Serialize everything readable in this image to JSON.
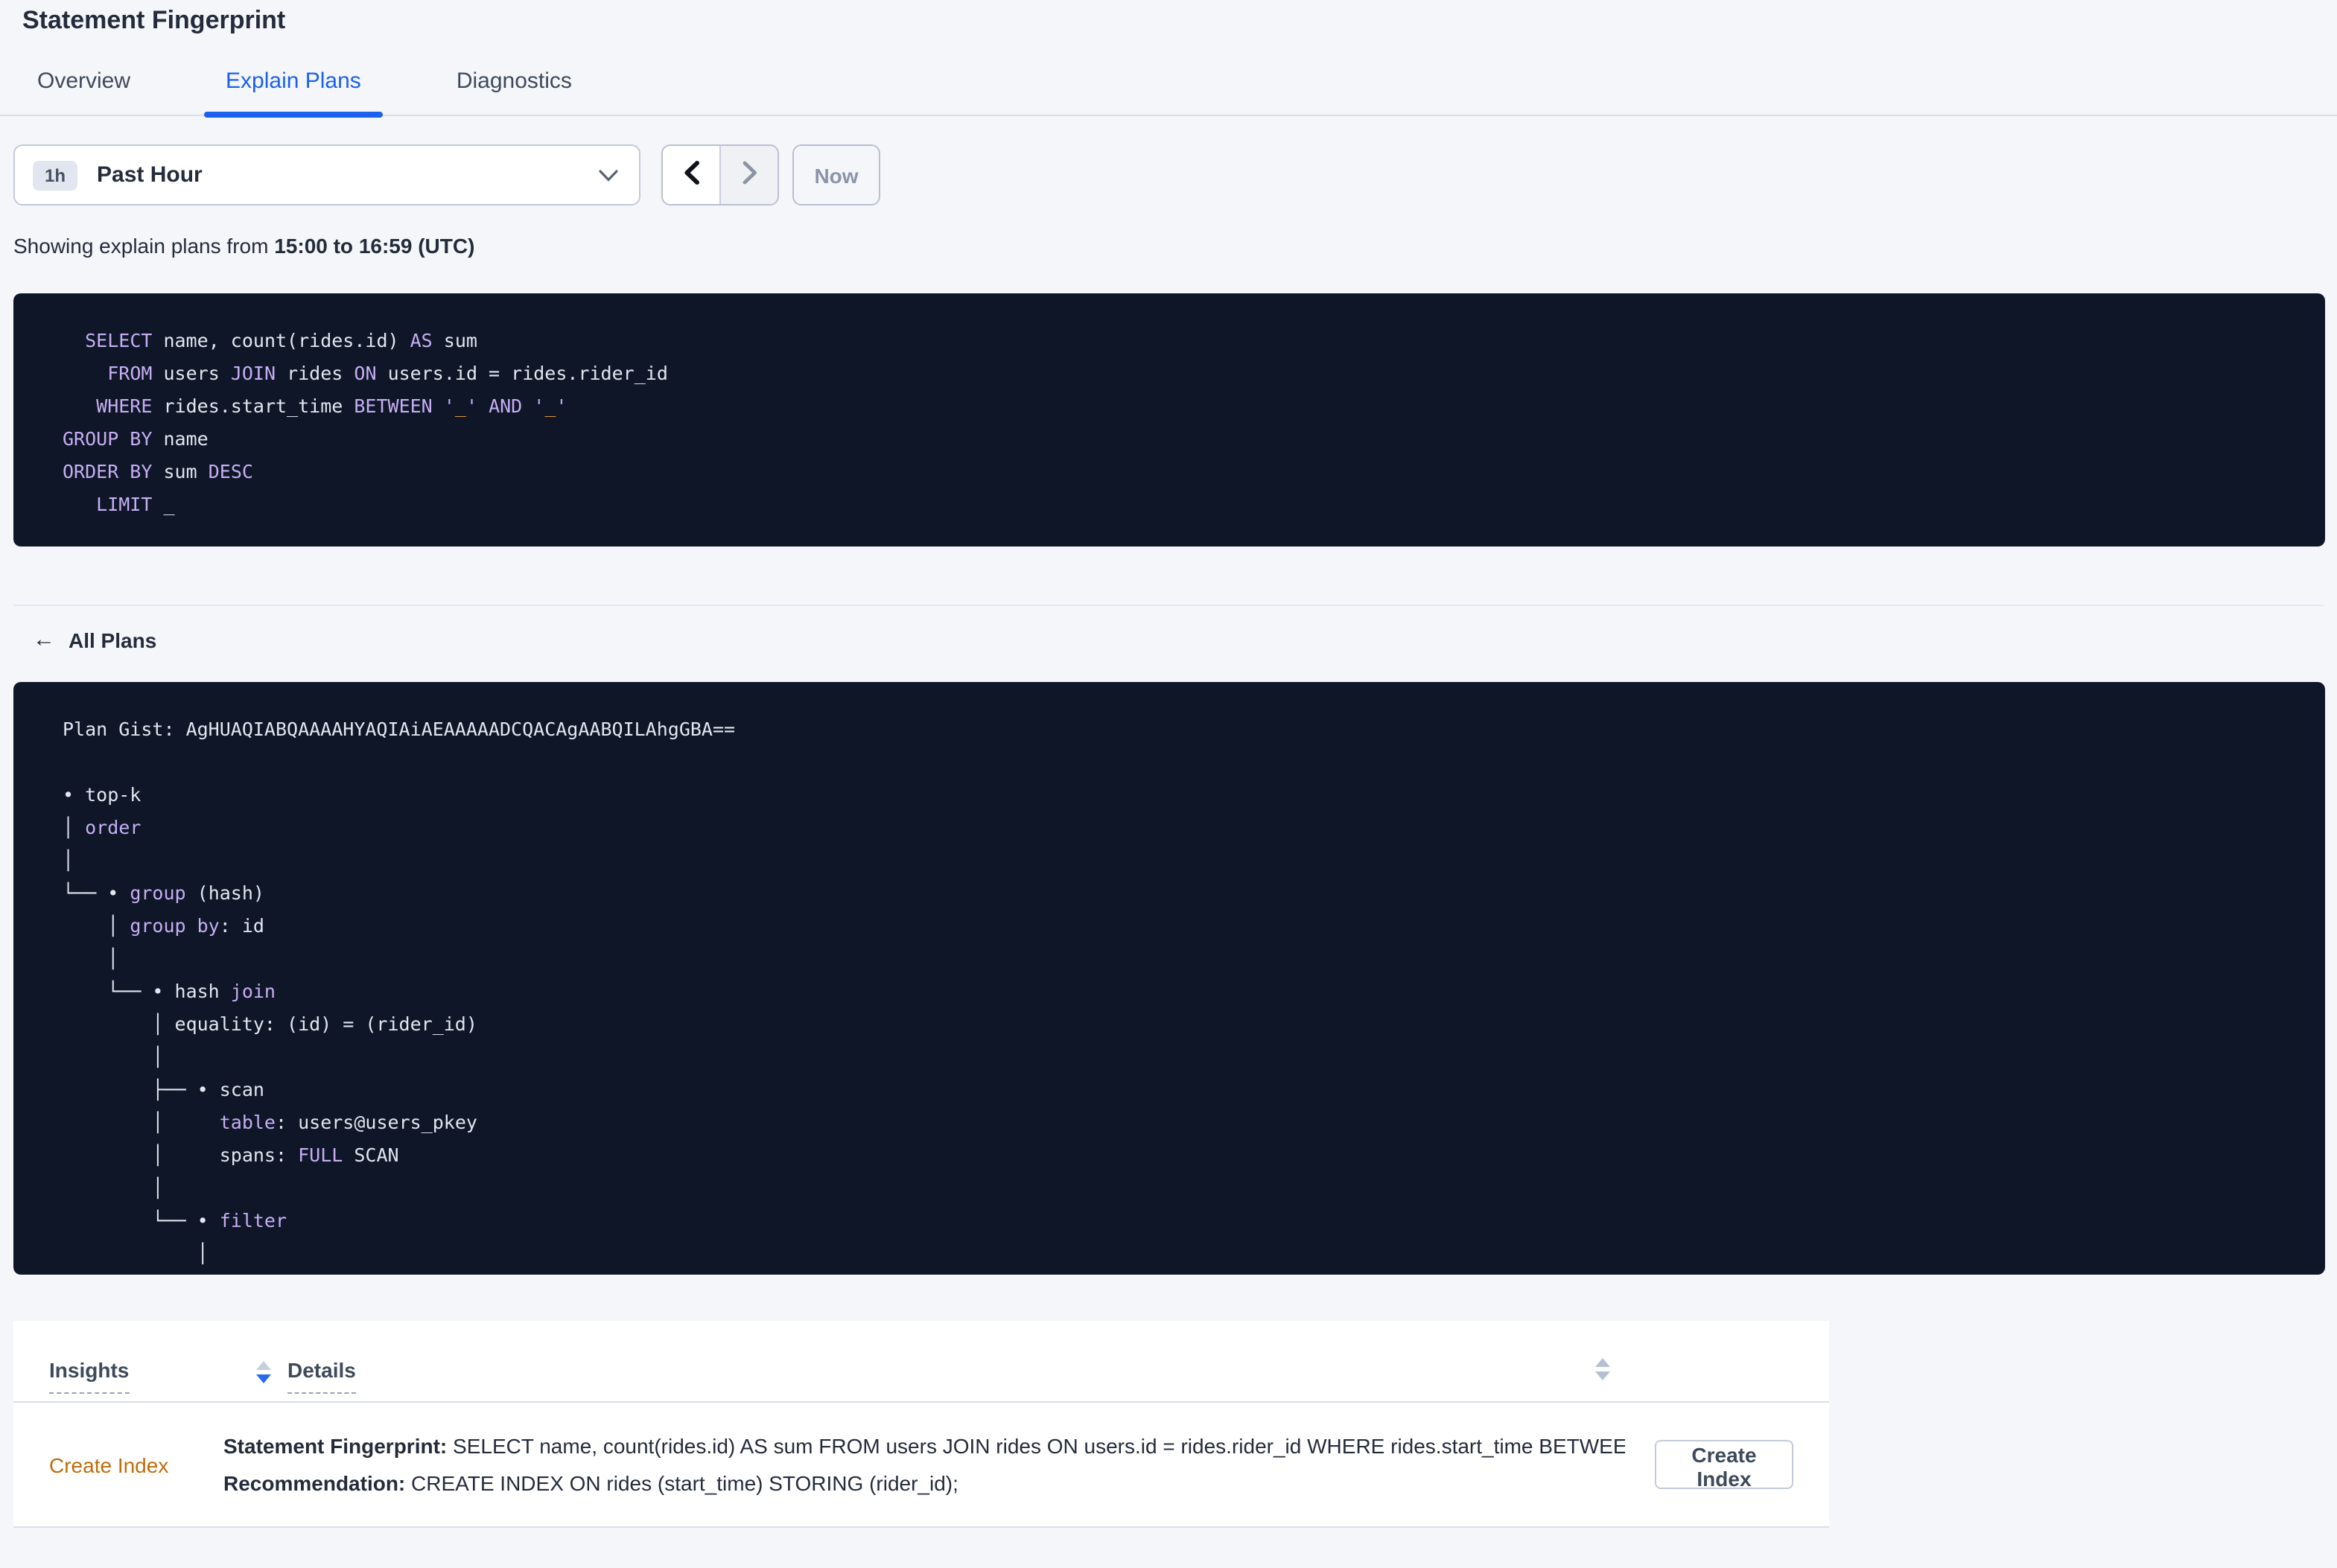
{
  "page": {
    "title": "Statement Fingerprint"
  },
  "tabs": [
    {
      "label": "Overview",
      "active": false
    },
    {
      "label": "Explain Plans",
      "active": true
    },
    {
      "label": "Diagnostics",
      "active": false
    }
  ],
  "time_picker": {
    "interval_badge": "1h",
    "selected_label": "Past Hour",
    "now_label": "Now"
  },
  "showing": {
    "prefix": "Showing explain plans from ",
    "range": "15:00 to 16:59 (UTC)"
  },
  "sql_block": {
    "lines": [
      [
        [
          "t",
          "  "
        ],
        [
          "k",
          "SELECT"
        ],
        [
          "t",
          " name, count(rides.id) "
        ],
        [
          "k",
          "AS"
        ],
        [
          "t",
          " sum"
        ]
      ],
      [
        [
          "t",
          "    "
        ],
        [
          "k",
          "FROM"
        ],
        [
          "t",
          " users "
        ],
        [
          "k",
          "JOIN"
        ],
        [
          "t",
          " rides "
        ],
        [
          "k",
          "ON"
        ],
        [
          "t",
          " users.id = rides.rider_id"
        ]
      ],
      [
        [
          "t",
          "   "
        ],
        [
          "k",
          "WHERE"
        ],
        [
          "t",
          " rides.start_time "
        ],
        [
          "k",
          "BETWEEN"
        ],
        [
          "t",
          " "
        ],
        [
          "k",
          "'"
        ],
        [
          "o",
          "_"
        ],
        [
          "k",
          "'"
        ],
        [
          "t",
          " "
        ],
        [
          "k",
          "AND"
        ],
        [
          "t",
          " "
        ],
        [
          "k",
          "'"
        ],
        [
          "o",
          "_"
        ],
        [
          "k",
          "'"
        ]
      ],
      [
        [
          "k",
          "GROUP BY"
        ],
        [
          "t",
          " name"
        ]
      ],
      [
        [
          "k",
          "ORDER BY"
        ],
        [
          "t",
          " sum "
        ],
        [
          "k",
          "DESC"
        ]
      ],
      [
        [
          "t",
          "   "
        ],
        [
          "k",
          "LIMIT"
        ],
        [
          "t",
          " _"
        ]
      ]
    ]
  },
  "all_plans_label": "All Plans",
  "plan_block": {
    "gist": "AgHUAQIABQAAAAHYAQIAiAEAAAAADCQACAgAABQILAhgGBA==",
    "lines": [
      [
        [
          "t",
          "Plan Gist: AgHUAQIABQAAAAHYAQIAiAEAAAAADCQACAgAABQILAhgGBA=="
        ]
      ],
      [],
      [
        [
          "t",
          "• top-k"
        ]
      ],
      [
        [
          "t",
          "│ "
        ],
        [
          "k",
          "order"
        ]
      ],
      [
        [
          "t",
          "│"
        ]
      ],
      [
        [
          "t",
          "└── • "
        ],
        [
          "k",
          "group"
        ],
        [
          "t",
          " (hash)"
        ]
      ],
      [
        [
          "t",
          "    │ "
        ],
        [
          "k",
          "group by"
        ],
        [
          "t",
          ": id"
        ]
      ],
      [
        [
          "t",
          "    │"
        ]
      ],
      [
        [
          "t",
          "    └── • hash "
        ],
        [
          "k",
          "join"
        ]
      ],
      [
        [
          "t",
          "        │ equality: (id) = (rider_id)"
        ]
      ],
      [
        [
          "t",
          "        │"
        ]
      ],
      [
        [
          "t",
          "        ├── • scan"
        ]
      ],
      [
        [
          "t",
          "        │     "
        ],
        [
          "k",
          "table"
        ],
        [
          "t",
          ": users@users_pkey"
        ]
      ],
      [
        [
          "t",
          "        │     spans: "
        ],
        [
          "k",
          "FULL"
        ],
        [
          "t",
          " SCAN"
        ]
      ],
      [
        [
          "t",
          "        │"
        ]
      ],
      [
        [
          "t",
          "        └── • "
        ],
        [
          "k",
          "filter"
        ]
      ],
      [
        [
          "t",
          "            │"
        ]
      ]
    ]
  },
  "insights_table": {
    "columns": [
      {
        "label": "Insights"
      },
      {
        "label": "Details"
      }
    ],
    "rows": [
      {
        "insight": "Create Index",
        "details": [
          {
            "label": "Statement Fingerprint:",
            "text": " SELECT name, count(rides.id) AS sum FROM users JOIN rides ON users.id = rides.rider_id WHERE rides.start_time BETWEEN '_…"
          },
          {
            "label": "Recommendation:",
            "text": " CREATE INDEX ON rides (start_time) STORING (rider_id);"
          }
        ],
        "action_label": "Create Index"
      }
    ]
  },
  "colors": {
    "accent_blue": "#1b61ee",
    "code_background": "#0e1628",
    "code_text": "#e2e6ee",
    "code_keyword": "#c7aef2",
    "code_placeholder_orange": "#e09b3d",
    "insight_link_orange": "#bf6d0b",
    "page_background": "#f4f6fa"
  }
}
